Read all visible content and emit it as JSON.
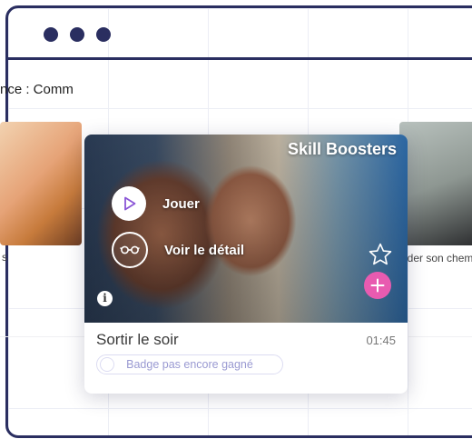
{
  "colors": {
    "window_border": "#2a2e60",
    "accent_pink": "#e85bb0",
    "play_icon": "#8a55d6",
    "badge_text": "#9a9ad2"
  },
  "window": {
    "controls": [
      "dot",
      "dot",
      "dot"
    ]
  },
  "section": {
    "title": "nce : Comm"
  },
  "row": {
    "left_caption": "s",
    "right_caption": "nder son chem"
  },
  "card": {
    "brand": "Skill Boosters",
    "actions": {
      "play_label": "Jouer",
      "play_icon": "play-icon",
      "detail_label": "Voir le détail",
      "detail_icon": "glasses-icon"
    },
    "icons": {
      "info": "info-icon",
      "favorite": "star-icon",
      "add": "plus-icon"
    },
    "info_glyph": "i",
    "title": "Sortir le soir",
    "duration": "01:45",
    "badge": "Badge pas encore gagné"
  }
}
